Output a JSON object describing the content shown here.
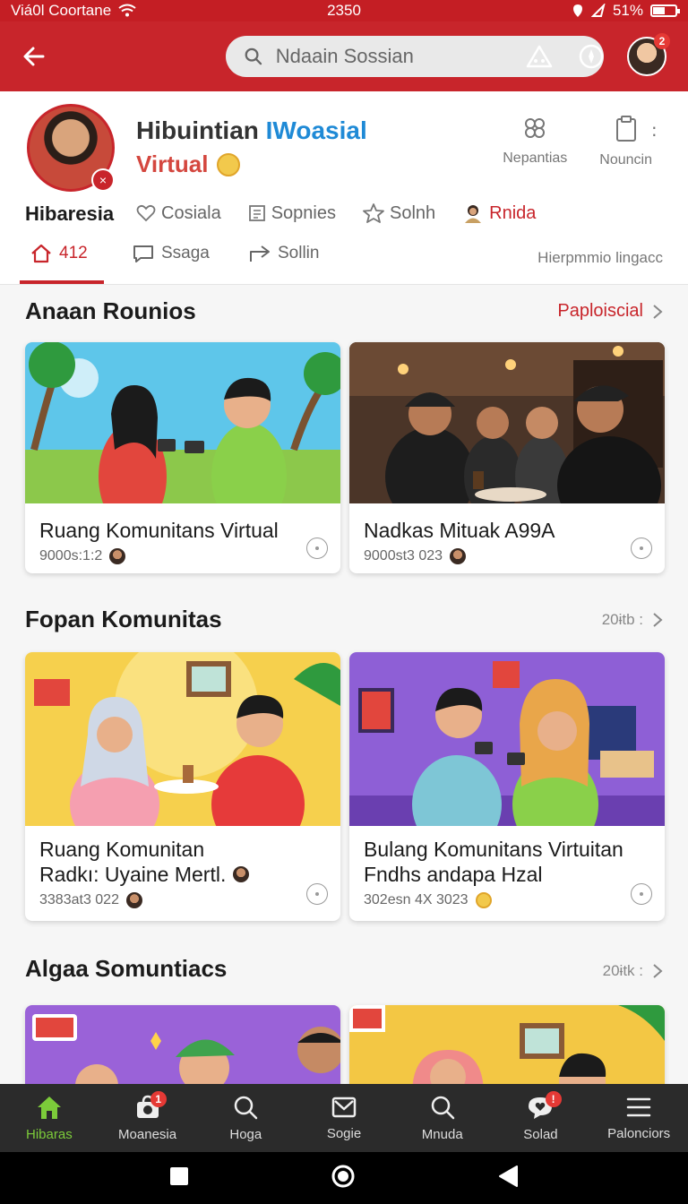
{
  "status_bar": {
    "carrier": "Viá0l Coortane",
    "time": "2350",
    "battery": "51%"
  },
  "top_bar": {
    "search_placeholder": "Ndaain Sossian",
    "avatar_badge": "2"
  },
  "profile": {
    "title_part1": "Hibuintian",
    "title_part2": "IWoasial",
    "subtitle": "Virtual",
    "actions": [
      {
        "label": "Nepantias",
        "icon": "flower-icon"
      },
      {
        "label": "Nouncin",
        "icon": "clipboard-icon"
      }
    ],
    "name": "Hibaresia",
    "chips": [
      {
        "label": "Cosiala",
        "icon": "heart-icon"
      },
      {
        "label": "Sopnies",
        "icon": "document-icon"
      },
      {
        "label": "Solnh",
        "icon": "star-icon"
      },
      {
        "label": "Rnida",
        "icon": "person-icon"
      }
    ],
    "tabs": [
      {
        "label": "412",
        "icon": "home-icon",
        "active": true
      },
      {
        "label": "Ssaga",
        "icon": "chat-icon"
      },
      {
        "label": "Sollin",
        "icon": "share-icon"
      }
    ],
    "tab_right": "Hierpmmio lingacc"
  },
  "sections": [
    {
      "title": "Anaan Rounios",
      "link": "Paploiscial",
      "cards": [
        {
          "title_lines": [
            "Ruang Komunitans Virtual"
          ],
          "meta": "9000s:1:2"
        },
        {
          "title_lines": [
            "Nadkas Mituak A99A"
          ],
          "meta": "9000st3 023"
        }
      ]
    },
    {
      "title": "Fopan Komunitas",
      "link": "20ɨtb :",
      "cards": [
        {
          "title_lines": [
            "Ruang Komunitan",
            "Radkı: Uyaine Mertl."
          ],
          "meta": "3383at3 022"
        },
        {
          "title_lines": [
            "Bulang Komunitans Virtuitan",
            "Fndhs andapa Hzal"
          ],
          "meta": "302esn 4X 3023"
        }
      ]
    },
    {
      "title": "Algaa Somuntiacs",
      "link": "20ɨtk :"
    }
  ],
  "bottom_nav": [
    {
      "label": "Hibaras",
      "icon": "home-icon",
      "active": true
    },
    {
      "label": "Moanesia",
      "icon": "camera-bag-icon",
      "badge": "1"
    },
    {
      "label": "Hoga",
      "icon": "search-icon"
    },
    {
      "label": "Sogie",
      "icon": "mail-icon"
    },
    {
      "label": "Mnuda",
      "icon": "search-icon"
    },
    {
      "label": "Solad",
      "icon": "chat-heart-icon",
      "badge": "!"
    },
    {
      "label": "Palonciors",
      "icon": "menu-icon"
    }
  ],
  "colors": {
    "brand_red": "#c8252b",
    "active_green": "#7ccb3a",
    "link_blue": "#1f8ad6"
  }
}
